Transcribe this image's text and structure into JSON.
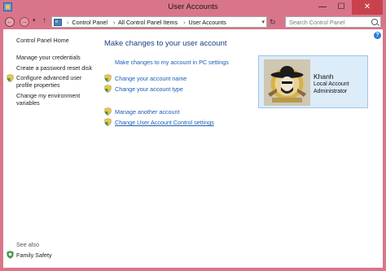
{
  "window": {
    "title": "User Accounts",
    "minimize": "—",
    "maximize": "☐",
    "close": "✕"
  },
  "address": {
    "crumbs": [
      "Control Panel",
      "All Control Panel Items",
      "User Accounts"
    ],
    "separator": "›",
    "search_placeholder": "Search Control Panel"
  },
  "sidebar": {
    "home": "Control Panel Home",
    "links": [
      "Manage your credentials",
      "Create a password reset disk",
      "Configure advanced user profile properties",
      "Change my environment variables"
    ],
    "see_also_label": "See also",
    "see_also_link": "Family Safety"
  },
  "main": {
    "heading": "Make changes to your user account",
    "pc_settings_link": "Make changes to my account in PC settings",
    "tasks": [
      "Change your account name",
      "Change your account type",
      "Manage another account",
      "Change User Account Control settings"
    ]
  },
  "user": {
    "name": "Khanh",
    "type": "Local Account",
    "role": "Administrator"
  },
  "colors": {
    "frame": "#d9758a",
    "link": "#1a5fb4",
    "heading": "#1a3e83",
    "card": "#dcecf8"
  }
}
